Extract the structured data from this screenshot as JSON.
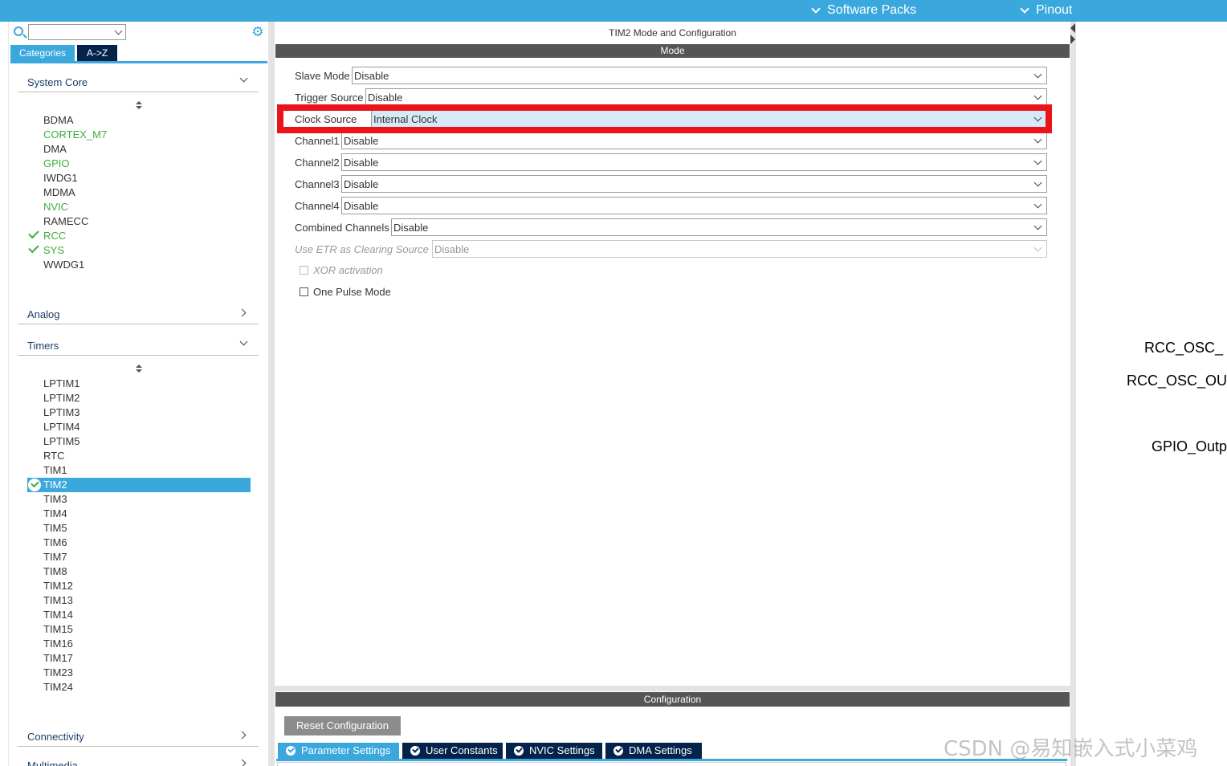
{
  "topbar": {
    "software_packs": "Software Packs",
    "pinout": "Pinout"
  },
  "left_panel": {
    "tabs": {
      "categories": "Categories",
      "az": "A->Z"
    },
    "categories": {
      "system_core": "System Core",
      "analog": "Analog",
      "timers": "Timers",
      "connectivity": "Connectivity",
      "multimedia": "Multimedia"
    },
    "system_core_items": [
      "BDMA",
      "CORTEX_M7",
      "DMA",
      "GPIO",
      "IWDG1",
      "MDMA",
      "NVIC",
      "RAMECC",
      "RCC",
      "SYS",
      "WWDG1"
    ],
    "timer_items": [
      "LPTIM1",
      "LPTIM2",
      "LPTIM3",
      "LPTIM4",
      "LPTIM5",
      "RTC",
      "TIM1",
      "TIM2",
      "TIM3",
      "TIM4",
      "TIM5",
      "TIM6",
      "TIM7",
      "TIM8",
      "TIM12",
      "TIM13",
      "TIM14",
      "TIM15",
      "TIM16",
      "TIM17",
      "TIM23",
      "TIM24"
    ]
  },
  "mode_panel": {
    "title": "TIM2 Mode and Configuration",
    "mode_header": "Mode",
    "fields": [
      {
        "label": "Slave Mode",
        "value": "Disable"
      },
      {
        "label": "Trigger Source",
        "value": "Disable"
      },
      {
        "label": "Clock Source",
        "value": "Internal Clock"
      },
      {
        "label": "Channel1",
        "value": "Disable"
      },
      {
        "label": "Channel2",
        "value": "Disable"
      },
      {
        "label": "Channel3",
        "value": "Disable"
      },
      {
        "label": "Channel4",
        "value": "Disable"
      },
      {
        "label": "Combined Channels",
        "value": "Disable"
      },
      {
        "label": "Use ETR as Clearing Source",
        "value": "Disable"
      }
    ],
    "xor_activation": "XOR activation",
    "one_pulse_mode": "One Pulse Mode",
    "config_header": "Configuration",
    "reset_button": "Reset Configuration",
    "config_tabs": [
      "Parameter Settings",
      "User Constants",
      "NVIC Settings",
      "DMA Settings"
    ]
  },
  "pinout_view": {
    "labels": [
      "RCC_OSC_",
      "RCC_OSC_OU",
      "GPIO_Outp"
    ]
  },
  "watermark": "CSDN @易知嵌入式小菜鸡",
  "colors": {
    "accent": "#3aa8dd",
    "dark_tab": "#03234b",
    "section_bar": "#555555",
    "highlight_box": "#e8141a",
    "enabled_green": "#3cae3c"
  }
}
